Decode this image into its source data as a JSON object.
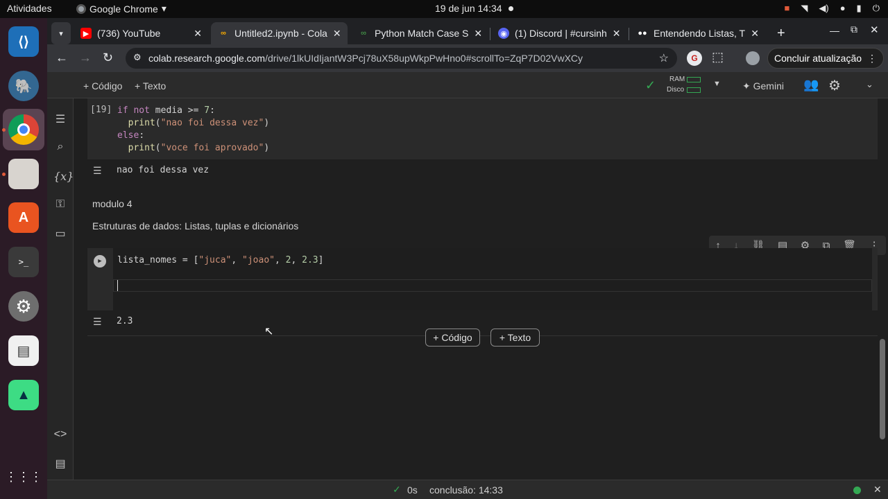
{
  "topbar": {
    "activities": "Atividades",
    "app_name": "Google Chrome",
    "app_arrow": "▾",
    "clock": "19 de jun  14:34"
  },
  "tabs": [
    {
      "title": "(736) YouTube",
      "icon": "youtube-icon",
      "color": "#ff0000"
    },
    {
      "title": "Untitled2.ipynb - Cola",
      "icon": "colab-icon",
      "color": "#f9ab00"
    },
    {
      "title": "Python Match Case S",
      "icon": "python-site-icon",
      "color": "#4caf50"
    },
    {
      "title": "(1) Discord | #cursinh",
      "icon": "discord-icon",
      "color": "#5865f2"
    },
    {
      "title": "Entendendo Listas, T",
      "icon": "medium-icon",
      "color": "#ffffff"
    }
  ],
  "tab_new": "+",
  "address": {
    "host": "colab.research.google.com",
    "path": "/drive/1lkUIdIjantW3Pcj78uX58upWkpPwHno0#scrollTo=ZqP7D02VwXCy",
    "update_label": "Concluir atualização"
  },
  "colab_bar": {
    "add_code": "+ Código",
    "add_text": "+ Texto",
    "ram_label": "RAM",
    "disk_label": "Disco",
    "gemini_label": "✦ Gemini"
  },
  "cell1": {
    "exec_count": "[19]",
    "output": "nao foi dessa vez"
  },
  "markdown": {
    "heading": "modulo 4",
    "subtitle": "Estruturas de dados: Listas, tuplas e dicionários"
  },
  "cell2": {
    "output": "2.3"
  },
  "insert_buttons": {
    "code": "+ Código",
    "text": "+ Texto"
  },
  "status": {
    "time": "0s",
    "completion": "conclusão: 14:33"
  }
}
